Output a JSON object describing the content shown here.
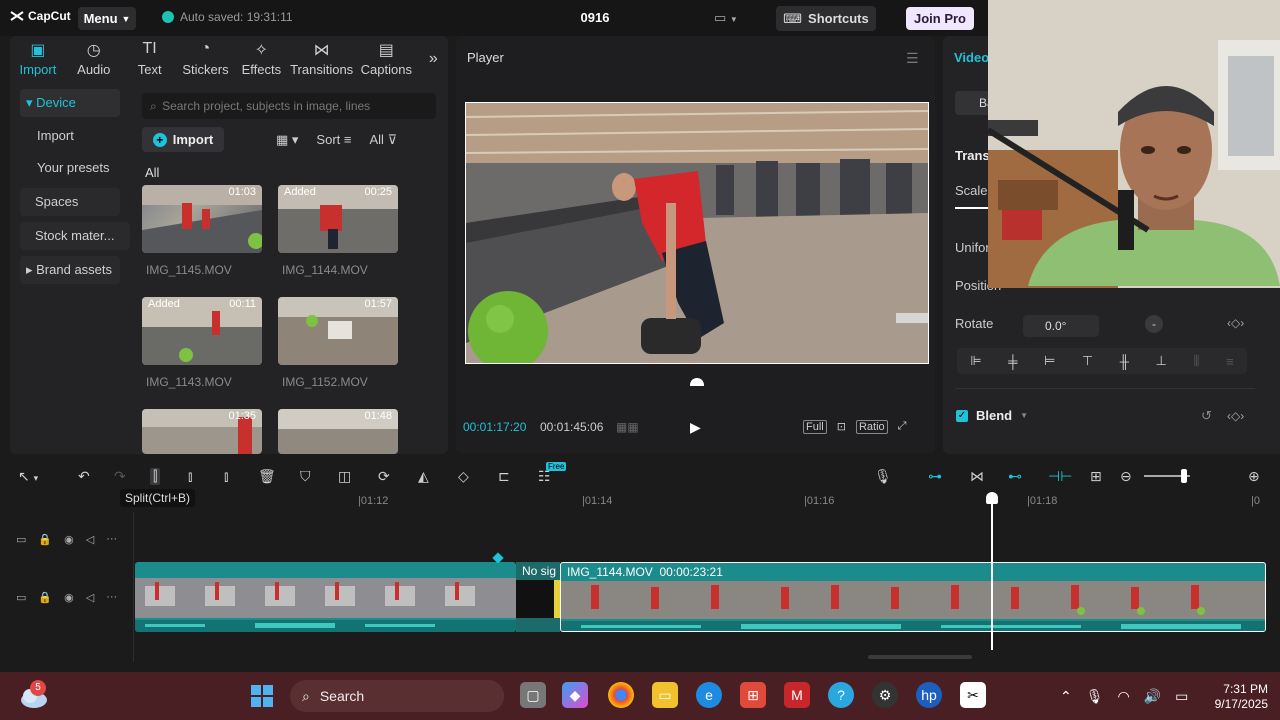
{
  "app": {
    "logo_text": "CapCut",
    "menu_label": "Menu",
    "autosave_text": "Auto saved: 19:31:11",
    "project_title": "0916",
    "shortcuts_label": "Shortcuts",
    "joinpro_label": "Join Pro"
  },
  "media_tabs": [
    {
      "label": "Import",
      "icon": "import-icon"
    },
    {
      "label": "Audio",
      "icon": "audio-icon"
    },
    {
      "label": "Text",
      "icon": "text-icon"
    },
    {
      "label": "Stickers",
      "icon": "stickers-icon"
    },
    {
      "label": "Effects",
      "icon": "effects-icon"
    },
    {
      "label": "Transitions",
      "icon": "transitions-icon"
    },
    {
      "label": "Captions",
      "icon": "captions-icon"
    }
  ],
  "left_nav": {
    "device": "Device",
    "import": "Import",
    "your_presets": "Your presets",
    "spaces": "Spaces",
    "stock": "Stock mater...",
    "brand": "Brand assets"
  },
  "media": {
    "search_placeholder": "Search project, subjects in image, lines",
    "import_label": "Import",
    "sort_label": "Sort",
    "all_filter": "All",
    "section_title": "All",
    "items": [
      {
        "name": "IMG_1145.MOV",
        "duration": "01:03",
        "added": ""
      },
      {
        "name": "IMG_1144.MOV",
        "duration": "00:25",
        "added": "Added"
      },
      {
        "name": "IMG_1143.MOV",
        "duration": "00:11",
        "added": "Added"
      },
      {
        "name": "IMG_1152.MOV",
        "duration": "01:57",
        "added": ""
      },
      {
        "name": "",
        "duration": "01:35",
        "added": ""
      },
      {
        "name": "",
        "duration": "01:48",
        "added": ""
      }
    ]
  },
  "player": {
    "title": "Player",
    "current_time": "00:01:17:20",
    "total_time": "00:01:45:06",
    "full_label": "Full",
    "ratio_label": "Ratio"
  },
  "right_panel": {
    "tab_video": "Video",
    "basic_tab": "Ba",
    "transform": "Transf",
    "scale": "Scale",
    "uniform": "Unifor",
    "position": "Position",
    "rotate": "Rotate",
    "rotate_value": "0.0°",
    "blend": "Blend"
  },
  "timeline": {
    "tooltip": "Split(Ctrl+B)",
    "ticks": [
      "|01:12",
      "|01:14",
      "|01:16",
      "|01:18",
      "|0"
    ],
    "clip_a_label": "",
    "gap_label": "No sig",
    "clip_b_label": "IMG_1144.MOV  00:00:23:21",
    "free_badge": "Free"
  },
  "taskbar": {
    "search_label": "Search",
    "time": "7:31 PM",
    "date": "9/17/2025",
    "weather_badge": "5"
  },
  "colors": {
    "accent": "#1fc2d8",
    "clip": "#1c8b8b",
    "taskbar": "#4a1f23"
  }
}
